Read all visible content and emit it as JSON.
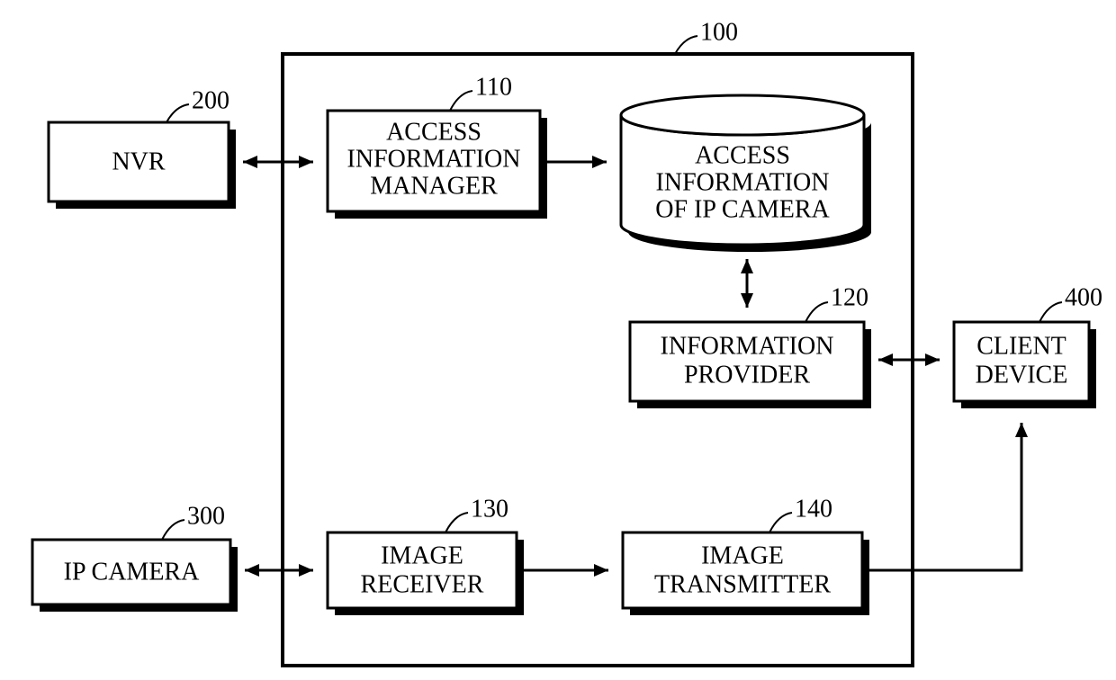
{
  "diagram": {
    "outer_ref": "100",
    "blocks": {
      "nvr": {
        "ref": "200",
        "lines": [
          "NVR"
        ]
      },
      "access_mgr": {
        "ref": "110",
        "lines": [
          "ACCESS",
          "INFORMATION",
          "MANAGER"
        ]
      },
      "cylinder": {
        "lines": [
          "ACCESS",
          "INFORMATION",
          "OF IP CAMERA"
        ]
      },
      "info_provider": {
        "ref": "120",
        "lines": [
          "INFORMATION",
          "PROVIDER"
        ]
      },
      "client": {
        "ref": "400",
        "lines": [
          "CLIENT",
          "DEVICE"
        ]
      },
      "ip_camera": {
        "ref": "300",
        "lines": [
          "IP CAMERA"
        ]
      },
      "img_receiver": {
        "ref": "130",
        "lines": [
          "IMAGE",
          "RECEIVER"
        ]
      },
      "img_transmitter": {
        "ref": "140",
        "lines": [
          "IMAGE",
          "TRANSMITTER"
        ]
      }
    }
  }
}
